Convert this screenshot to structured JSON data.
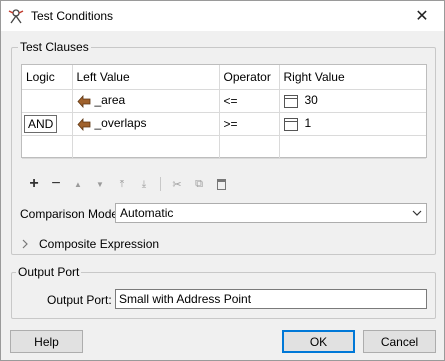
{
  "window": {
    "title": "Test Conditions",
    "close_glyph": "✕"
  },
  "clauses": {
    "group_title": "Test Clauses",
    "columns": [
      "Logic",
      "Left Value",
      "Operator",
      "Right Value"
    ],
    "rows": [
      {
        "logic": "",
        "left": "_area",
        "operator": "<=",
        "right": "30"
      },
      {
        "logic": "AND",
        "left": "_overlaps",
        "operator": ">=",
        "right": "1"
      },
      {
        "logic": "",
        "left": "",
        "operator": "",
        "right": ""
      }
    ]
  },
  "toolbar": {
    "add": "+",
    "remove": "−",
    "move_up": "▲",
    "move_down": "▼",
    "move_top": "⤒",
    "move_bottom": "⤓",
    "cut": "✂",
    "copy": "⧉",
    "paste": "📋"
  },
  "comparison_mode": {
    "label": "Comparison Mode:",
    "value": "Automatic",
    "arrow": "⌵"
  },
  "composite": {
    "label": "Composite Expression",
    "chevron": "›"
  },
  "output": {
    "group_title": "Output Port",
    "label": "Output Port:",
    "value": "Small with Address Point"
  },
  "buttons": {
    "help": "Help",
    "ok": "OK",
    "cancel": "Cancel"
  },
  "colors": {
    "attr_icon": "#a0622d",
    "border": "#adadad",
    "button_bg": "#e1e1e1"
  }
}
